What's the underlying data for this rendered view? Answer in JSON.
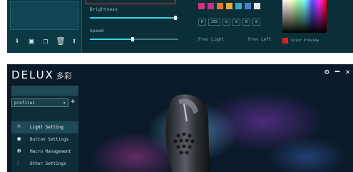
{
  "lighting": {
    "brightness_label": "Brightness",
    "brightness_value": 0.97,
    "speed_label": "Speed",
    "speed_value": 0.48,
    "swatches": [
      "#d6327a",
      "#c2328a",
      "#e07a2e",
      "#e8a93a",
      "#3aa7c8",
      "#4a7fd0",
      "#e8e8e8"
    ],
    "rgb_fields": [
      "R",
      "255",
      "G",
      "0",
      "B",
      "0"
    ],
    "prev_left": "Prev Light",
    "prev_right": "Prev Left",
    "current_color": "#e41e1e",
    "current_color_label": "Color Preview"
  },
  "app": {
    "logo": "DELUX",
    "logo_cn": "多彩",
    "profile_value": "profile1"
  },
  "menu": [
    {
      "label": "Light Setting",
      "icon": "sun-icon"
    },
    {
      "label": "Button Settings",
      "icon": "mouse-button-icon"
    },
    {
      "label": "Macro Management",
      "icon": "macro-icon"
    },
    {
      "label": "Other Settings",
      "icon": "sliders-icon"
    }
  ]
}
